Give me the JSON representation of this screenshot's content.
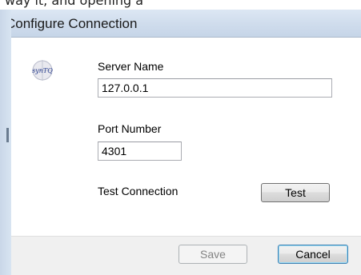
{
  "background_window": {
    "partial_text": "way it, and opening a"
  },
  "dialog": {
    "title": "Configure Connection",
    "logo_text": "synTQ",
    "server_name": {
      "label": "Server Name",
      "value": "127.0.0.1"
    },
    "port_number": {
      "label": "Port Number",
      "value": "4301"
    },
    "test_connection": {
      "label": "Test Connection",
      "button_label": "Test"
    },
    "footer": {
      "save_label": "Save",
      "cancel_label": "Cancel"
    }
  },
  "colors": {
    "titlebar": "#cfdcec",
    "client_background": "#ffffff",
    "footer_background": "#f0f0f0",
    "default_button_border": "#3c7fb1",
    "logo_text": "#2a3f8f"
  }
}
